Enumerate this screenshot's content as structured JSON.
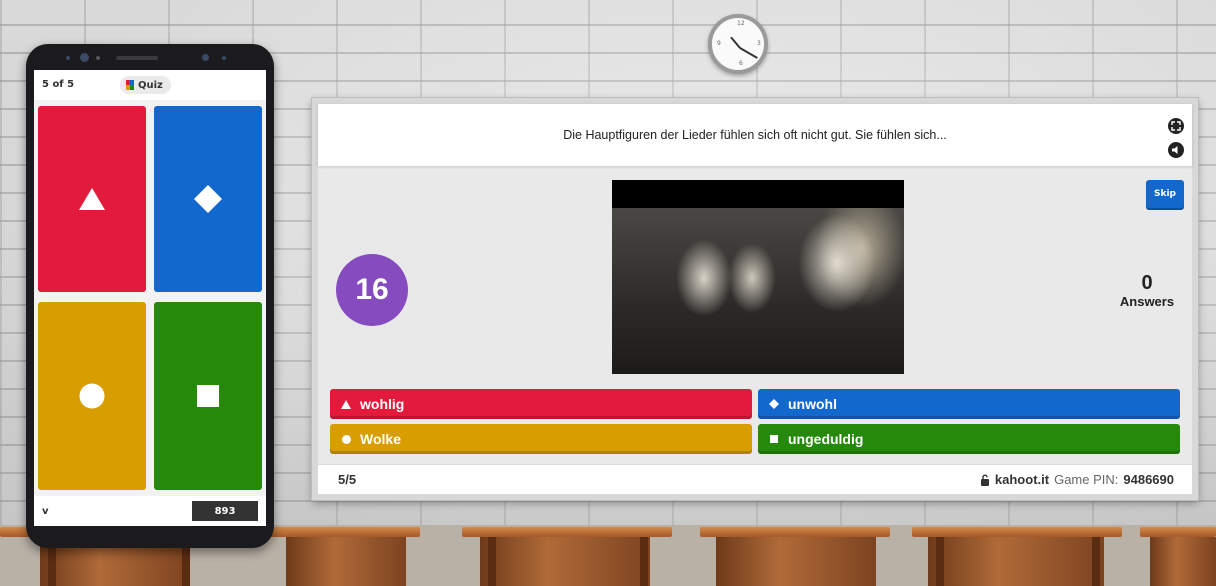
{
  "colors": {
    "red": "#e21b3c",
    "blue": "#1368ce",
    "yellow": "#d89e00",
    "green": "#26890c",
    "timer_purple": "#864cbf"
  },
  "phone": {
    "counter": "5 of 5",
    "quiz_label": "Quiz",
    "tiles": [
      {
        "shape": "triangle",
        "color": "#e21b3c"
      },
      {
        "shape": "diamond",
        "color": "#1368ce"
      },
      {
        "shape": "circle",
        "color": "#d89e00"
      },
      {
        "shape": "square",
        "color": "#26890c"
      }
    ],
    "player_name": "v",
    "score": "893"
  },
  "board": {
    "question": "Die Hauptfiguren der Lieder fühlen sich oft nicht gut. Sie fühlen sich...",
    "timer": "16",
    "skip_label": "Skip",
    "answers_count": "0",
    "answers_label": "Answers",
    "answers": [
      {
        "text": "wohlig",
        "shape": "triangle-icon",
        "color": "#e21b3c"
      },
      {
        "text": "unwohl",
        "shape": "diamond-icon",
        "color": "#1368ce"
      },
      {
        "text": "Wolke",
        "shape": "circle-icon",
        "color": "#d89e00"
      },
      {
        "text": "ungeduldig",
        "shape": "square-icon",
        "color": "#26890c"
      }
    ],
    "progress": "5/5",
    "site": "kahoot.it",
    "pin_label": "Game PIN:",
    "pin": "9486690"
  }
}
